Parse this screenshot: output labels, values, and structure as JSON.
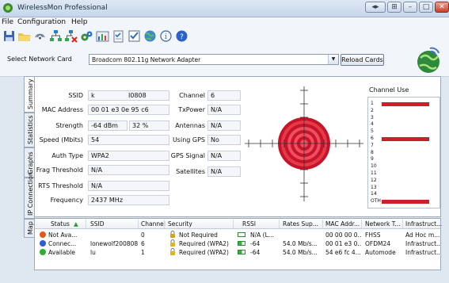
{
  "app": {
    "title": "WirelessMon Professional",
    "window_buttons": {
      "minimize": "–",
      "maximize": "□",
      "close": "✕",
      "extra1": "◂▸",
      "extra2": "⊞"
    }
  },
  "menu": {
    "items": [
      "File",
      "Configuration",
      "Help"
    ]
  },
  "toolbar": {
    "icons": [
      "save-icon",
      "open-folder-icon",
      "radio-waves-icon",
      "network-icon",
      "network-remove-icon",
      "gears-icon",
      "chart-icon",
      "clipboard-icon",
      "checklist-icon",
      "globe-icon",
      "info-icon",
      "help-icon"
    ]
  },
  "card": {
    "label": "Select Network Card",
    "value": "Broadcom 802.11g Network Adapter",
    "reload_label": "Reload Cards"
  },
  "side_tabs": [
    "Summary",
    "Statistics",
    "Graphs",
    "IP Connection",
    "Map"
  ],
  "summary": {
    "ssid_label": "SSID",
    "ssid_value": "k",
    "ssid_value2": "I0808",
    "mac_label": "MAC Address",
    "mac_value": "00 01 e3 0e 95 c6",
    "strength_label": "Strength",
    "strength_value": "-64 dBm",
    "strength_pct": "32 %",
    "speed_label": "Speed (Mbits)",
    "speed_value": "54",
    "auth_label": "Auth Type",
    "auth_value": "WPA2",
    "frag_label": "Frag Threshold",
    "frag_value": "N/A",
    "rts_label": "RTS Threshold",
    "rts_value": "N/A",
    "freq_label": "Frequency",
    "freq_value": "2437 MHz",
    "channel_label": "Channel",
    "channel_value": "6",
    "txpower_label": "TxPower",
    "txpower_value": "N/A",
    "antennas_label": "Antennas",
    "antennas_value": "N/A",
    "gps_label": "Using GPS",
    "gps_value": "No",
    "gps_signal_label": "GPS Signal",
    "gps_signal_value": "N/A",
    "satellites_label": "Satellites",
    "satellites_value": "N/A"
  },
  "channel_use": {
    "header": "Channel Use",
    "channels": [
      {
        "label": "1",
        "use": 0.85
      },
      {
        "label": "2",
        "use": 0
      },
      {
        "label": "3",
        "use": 0
      },
      {
        "label": "4",
        "use": 0
      },
      {
        "label": "5",
        "use": 0
      },
      {
        "label": "6",
        "use": 0.85
      },
      {
        "label": "7",
        "use": 0
      },
      {
        "label": "8",
        "use": 0
      },
      {
        "label": "9",
        "use": 0
      },
      {
        "label": "10",
        "use": 0
      },
      {
        "label": "11",
        "use": 0
      },
      {
        "label": "12",
        "use": 0
      },
      {
        "label": "13",
        "use": 0
      },
      {
        "label": "14",
        "use": 0
      },
      {
        "label": "OTH",
        "use": 0.85
      }
    ],
    "bar_color": "#cc1f2a"
  },
  "networks": {
    "columns": [
      "Status",
      "SSID",
      "Channel",
      "Security",
      "RSSI",
      "Rates Sup...",
      "MAC Addr...",
      "Network T...",
      "Infrastruct..."
    ],
    "sort_indicator": "▲",
    "rows": [
      {
        "status": "Not Ava...",
        "status_color": "#e05a1c",
        "ssid": "",
        "channel": "0",
        "security": "Not Required",
        "lock_color": "#d9a21a",
        "rssi": "N/A (L...",
        "rssi_on": false,
        "rates": "",
        "mac": "00 00 00 0...",
        "network": "FHSS",
        "infra": "Ad Hoc m..."
      },
      {
        "status": "Connec...",
        "status_color": "#2b5fd0",
        "ssid": "lonewolf200808",
        "channel": "6",
        "security": "Required (WPA2)",
        "lock_color": "#e0b21c",
        "rssi": "-64",
        "rssi_on": true,
        "rates": "54.0 Mb/s...",
        "mac": "00 01 e3 0...",
        "network": "OFDM24",
        "infra": "Infrastruct..."
      },
      {
        "status": "Available",
        "status_color": "#2fae35",
        "ssid": "lu",
        "channel": "1",
        "security": "Required (WPA2)",
        "lock_color": "#e0b21c",
        "rssi": "-64",
        "rssi_on": true,
        "rates": "54.0 Mb/s...",
        "mac": "54 e6 fc 4...",
        "network": "Automode",
        "infra": "Infrastruct..."
      }
    ]
  }
}
